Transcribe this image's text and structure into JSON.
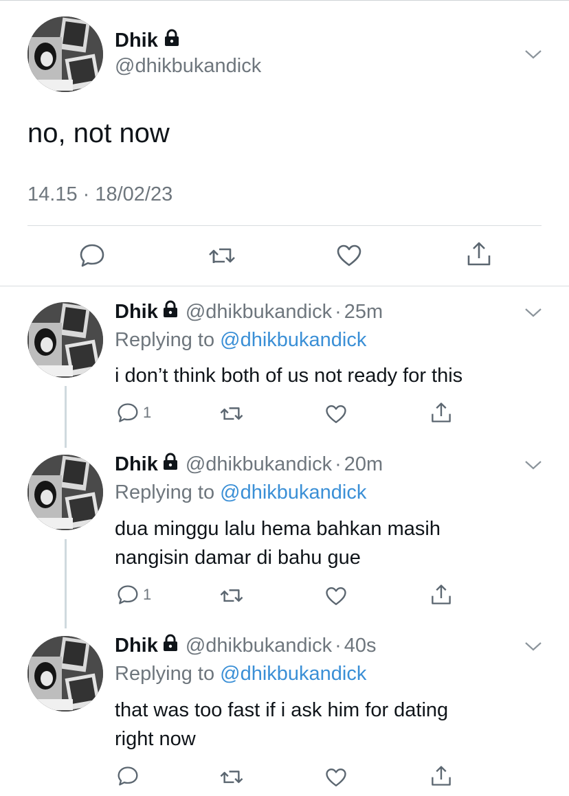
{
  "main": {
    "name": "Dhik",
    "handle": "@dhikbukandick",
    "text": "no, not now",
    "timestamp": "14.15 · 18/02/23",
    "icons": [
      "lock-icon",
      "chevron-down-icon",
      "reply-icon",
      "retweet-icon",
      "like-icon",
      "share-icon"
    ]
  },
  "replies": [
    {
      "name": "Dhik",
      "handle": "@dhikbukandick",
      "dot": "·",
      "time": "25m",
      "replying_prefix": "Replying to",
      "replying_to": "@dhikbukandick",
      "text": "i don’t think both of us not ready for this",
      "reply_count": "1"
    },
    {
      "name": "Dhik",
      "handle": "@dhikbukandick",
      "dot": "·",
      "time": "20m",
      "replying_prefix": "Replying to",
      "replying_to": "@dhikbukandick",
      "text_line1": "dua minggu lalu hema bahkan masih",
      "text_line2": "nangisin damar di bahu gue",
      "reply_count": "1"
    },
    {
      "name": "Dhik",
      "handle": "@dhikbukandick",
      "dot": "·",
      "time": "40s",
      "replying_prefix": "Replying to",
      "replying_to": "@dhikbukandick",
      "text_line1": "that was too fast if i ask him for dating",
      "text_line2": "right now",
      "reply_count": ""
    }
  ],
  "colors": {
    "text": "#0f1419",
    "muted": "#6e767d",
    "link": "#3a8fd6",
    "divider": "#d8dcdf"
  }
}
